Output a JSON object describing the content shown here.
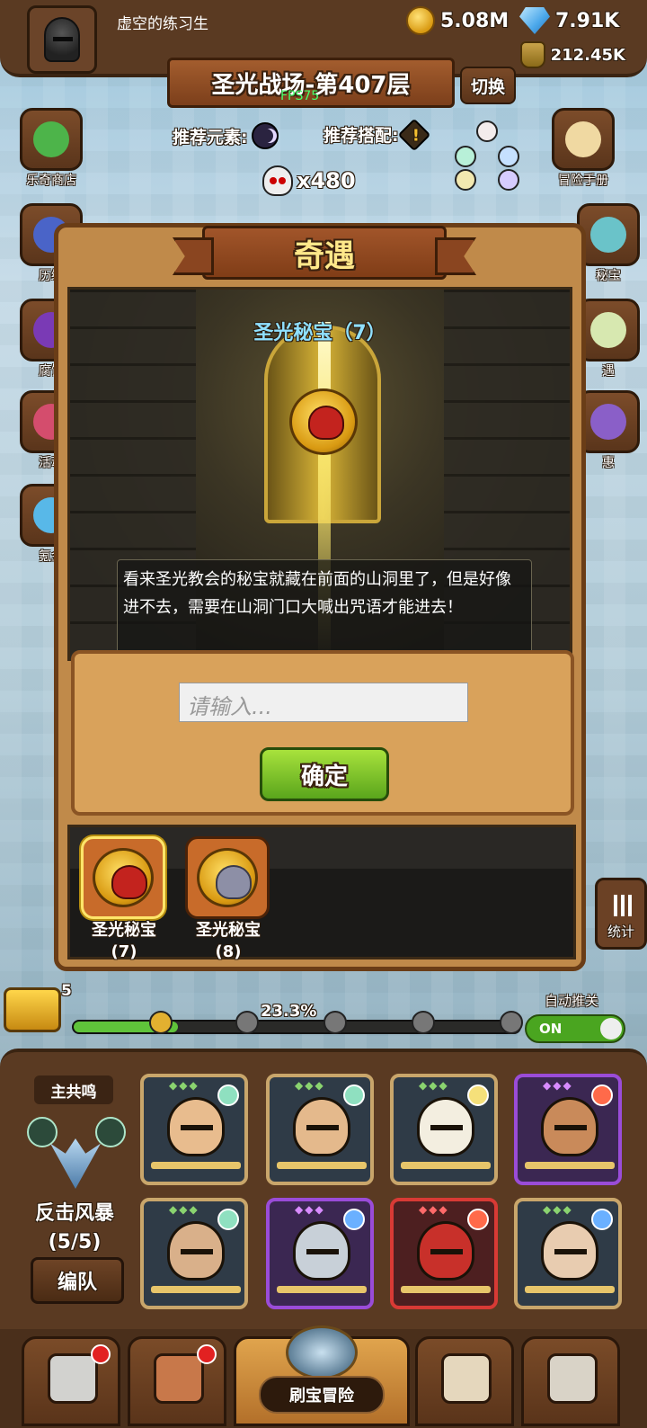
{
  "player": {
    "name": "虚空的练习生"
  },
  "resources": {
    "gold": "5.08M",
    "gems": "7.91K",
    "energy": "212.45K"
  },
  "stage": {
    "title": "圣光战场-第407层",
    "switch_label": "切换",
    "fps": "FPS75"
  },
  "recommend": {
    "element_label": "推荐元素:",
    "combo_label": "推荐搭配:"
  },
  "skull_count": "x480",
  "side_left": [
    {
      "label": "乐奇商店",
      "icon": "clover-icon"
    },
    {
      "label": "历练",
      "icon": "vase-icon"
    },
    {
      "label": "腐蚀",
      "icon": "orb-icon"
    },
    {
      "label": "活动",
      "icon": "gift-icon"
    },
    {
      "label": "氪金",
      "icon": "diamond-icon"
    }
  ],
  "side_right": [
    {
      "label": "冒险手册",
      "icon": "scroll-icon"
    },
    {
      "label": "秘宝",
      "icon": "chest-icon"
    },
    {
      "label": "遇",
      "icon": "quest-icon"
    },
    {
      "label": "惠",
      "icon": "box-icon"
    }
  ],
  "modal": {
    "title": "奇遇",
    "scene_title": "圣光秘宝（7）",
    "description": "看来圣光教会的秘宝就藏在前面的山洞里了，但是好像进不去，需要在山洞门口大喊出咒语才能进去！",
    "input_placeholder": "请输入...",
    "confirm_label": "确定",
    "treasures": [
      {
        "name": "圣光秘宝",
        "num": "(7)",
        "selected": true
      },
      {
        "name": "圣光秘宝",
        "num": "(8)",
        "selected": false
      }
    ]
  },
  "stats_label": "统计",
  "progress": {
    "chest_count": "5",
    "percent_text": "23.3%",
    "value": 0.233,
    "auto_label": "自动推关",
    "toggle": "ON"
  },
  "team": {
    "tag": "主共鸣",
    "resonance": "反击风暴",
    "resonance_count": "(5/5)",
    "formation_label": "编队"
  },
  "nav": {
    "main_label": "刷宝冒险"
  },
  "colors": {
    "gold": "#ffe88a",
    "green_button": "#5aa51c",
    "wood": "#5a3a22",
    "cyan_title": "#8fe0ff"
  }
}
